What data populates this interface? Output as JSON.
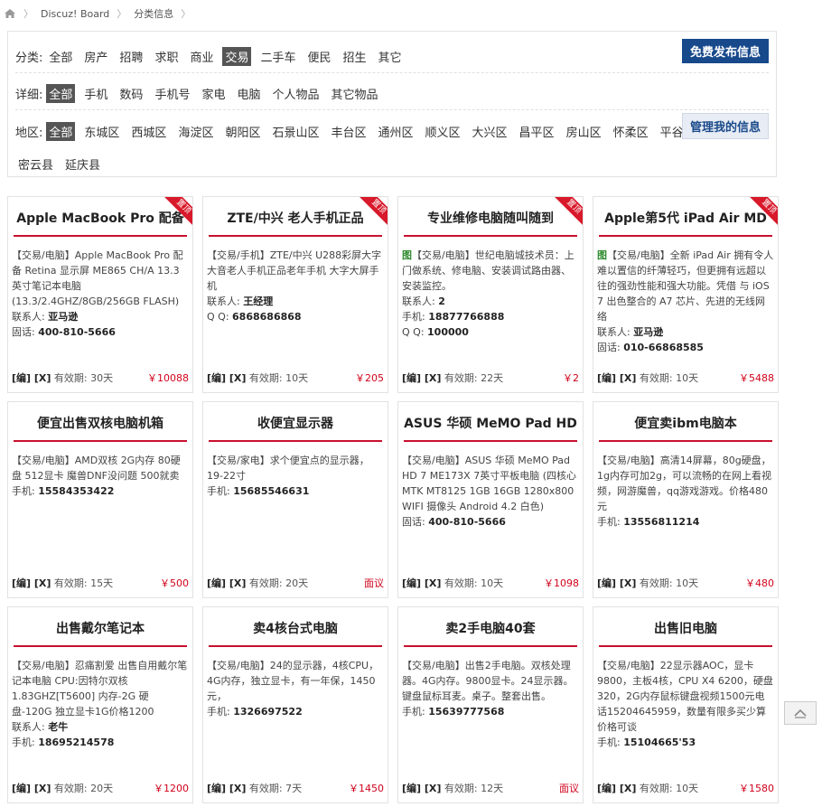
{
  "breadcrumb": {
    "home_icon": "home-icon",
    "items": [
      "Discuz! Board",
      "分类信息"
    ]
  },
  "filter": {
    "category_label": "分类:",
    "categories": [
      "全部",
      "房产",
      "招聘",
      "求职",
      "商业",
      "交易",
      "二手车",
      "便民",
      "招生",
      "其它"
    ],
    "category_selected": "交易",
    "detail_label": "详细:",
    "details": [
      "全部",
      "手机",
      "数码",
      "手机号",
      "家电",
      "电脑",
      "个人物品",
      "其它物品"
    ],
    "detail_selected": "全部",
    "area_label": "地区:",
    "areas": [
      "全部",
      "东城区",
      "西城区",
      "海淀区",
      "朝阳区",
      "石景山区",
      "丰台区",
      "通州区",
      "顺义区",
      "大兴区",
      "昌平区",
      "房山区",
      "怀柔区",
      "平谷区"
    ],
    "areas_row2": [
      "密云县",
      "延庆县"
    ],
    "area_selected": "全部",
    "publish_button": "免费发布信息",
    "manage_button": "管理我的信息"
  },
  "ribbon_text": "置顶",
  "edit_label": "[编]",
  "delete_label": "[X]",
  "cards": [
    {
      "title": "Apple MacBook Pro 配备",
      "sticky": true,
      "pic": false,
      "desc": "【交易/电脑】Apple MacBook Pro 配备 Retina 显示屏 ME865 CH/A 13.3英寸笔记本电脑(13.3/2.4GHZ/8GB/256GB FLASH)",
      "rows": [
        [
          "联系人:",
          "亚马逊"
        ],
        [
          "固话:",
          "400-810-5666"
        ]
      ],
      "valid": "有效期: 30天",
      "price": "￥10088"
    },
    {
      "title": "ZTE/中兴 老人手机正品",
      "sticky": true,
      "pic": false,
      "desc": "【交易/手机】ZTE/中兴 U288彩屏大字大音老人手机正品老年手机 大字大屏手机",
      "rows": [
        [
          "联系人:",
          "王经理"
        ],
        [
          "Q Q:",
          "6868686868"
        ]
      ],
      "valid": "有效期: 10天",
      "price": "￥205"
    },
    {
      "title": "专业维修电脑随叫随到",
      "sticky": true,
      "pic": true,
      "desc": "【交易/电脑】世纪电脑城技术员：上门做系统、修电脑、安装调试路由器、安装监控。",
      "rows": [
        [
          "联系人:",
          "2"
        ],
        [
          "手机:",
          "18877766888"
        ],
        [
          "Q Q:",
          "100000"
        ]
      ],
      "valid": "有效期: 22天",
      "price": "￥2"
    },
    {
      "title": "Apple第5代 iPad Air MD",
      "sticky": true,
      "pic": true,
      "desc": "【交易/电脑】全新 iPad Air 拥有令人难以置信的纤薄轻巧，但更拥有远超以往的强劲性能和强大功能。凭借 与 iOS 7 出色整合的 A7 芯片、先进的无线网络",
      "rows": [
        [
          "联系人:",
          "亚马逊"
        ],
        [
          "固话:",
          "010-66868585"
        ]
      ],
      "valid": "有效期: 10天",
      "price": "￥5488"
    },
    {
      "title": "便宜出售双核电脑机箱",
      "sticky": false,
      "pic": false,
      "desc": "【交易/电脑】AMD双核 2G内存 80硬盘 512显卡 魔兽DNF没问题 500就卖",
      "rows": [
        [
          "手机:",
          "15584353422"
        ]
      ],
      "valid": "有效期: 15天",
      "price": "￥500"
    },
    {
      "title": "收便宜显示器",
      "sticky": false,
      "pic": false,
      "desc": "【交易/家电】求个便宜点的显示器，19-22寸",
      "rows": [
        [
          "手机:",
          "15685546631"
        ]
      ],
      "valid": "有效期: 20天",
      "price": "面议"
    },
    {
      "title": "ASUS 华硕 MeMO Pad HD",
      "sticky": false,
      "pic": false,
      "desc": "【交易/电脑】ASUS 华硕 MeMO Pad HD 7 ME173X 7英寸平板电脑 (四核心MTK MT8125 1GB 16GB 1280x800 WIFI 摄像头 Android 4.2 白色)",
      "rows": [
        [
          "固话:",
          "400-810-5666"
        ]
      ],
      "valid": "有效期: 10天",
      "price": "￥1098"
    },
    {
      "title": "便宜卖ibm电脑本",
      "sticky": false,
      "pic": false,
      "desc": "【交易/电脑】高清14屏幕，80g硬盘，1g内存可加2g，可以流畅的在网上看视频，网游魔兽，qq游戏游戏。价格480元",
      "rows": [
        [
          "手机:",
          "13556811214"
        ]
      ],
      "valid": "有效期: 10天",
      "price": "￥480"
    },
    {
      "title": "出售戴尔笔记本",
      "sticky": false,
      "pic": false,
      "desc": "【交易/电脑】忍痛割爱 出售自用戴尔笔记本电脑 CPU:因特尔双核1.83GHZ[T5600] 内存-2G 硬盘-120G 独立显卡1G价格1200",
      "rows": [
        [
          "联系人:",
          "老牛"
        ],
        [
          "手机:",
          "18695214578"
        ]
      ],
      "valid": "有效期: 20天",
      "price": "￥1200"
    },
    {
      "title": "卖4核台式电脑",
      "sticky": false,
      "pic": false,
      "desc": "【交易/电脑】24的显示器，4核CPU，4G内存，独立显卡，有一年保，1450元，",
      "rows": [
        [
          "手机:",
          "1326697522"
        ]
      ],
      "valid": "有效期: 7天",
      "price": "￥1450"
    },
    {
      "title": "卖2手电脑40套",
      "sticky": false,
      "pic": false,
      "desc": "【交易/电脑】出售2手电脑。双核处理器。4G内存。9800显卡。24显示器。键盘鼠标耳麦。桌子。整套出售。",
      "rows": [
        [
          "手机:",
          "15639777568"
        ]
      ],
      "valid": "有效期: 12天",
      "price": "面议"
    },
    {
      "title": "出售旧电脑",
      "sticky": false,
      "pic": false,
      "desc": "【交易/电脑】22显示器AOC，显卡9800，主板4核，CPU X4 6200，硬盘320，2G内存鼠标键盘视频1500元电话15204645959，数量有限多买少算价格可谈",
      "rows": [
        [
          "手机:",
          "15104665'53"
        ]
      ],
      "valid": "有效期: 10天",
      "price": "￥1580"
    }
  ],
  "back_to_top_icon": "arrow-up-icon"
}
